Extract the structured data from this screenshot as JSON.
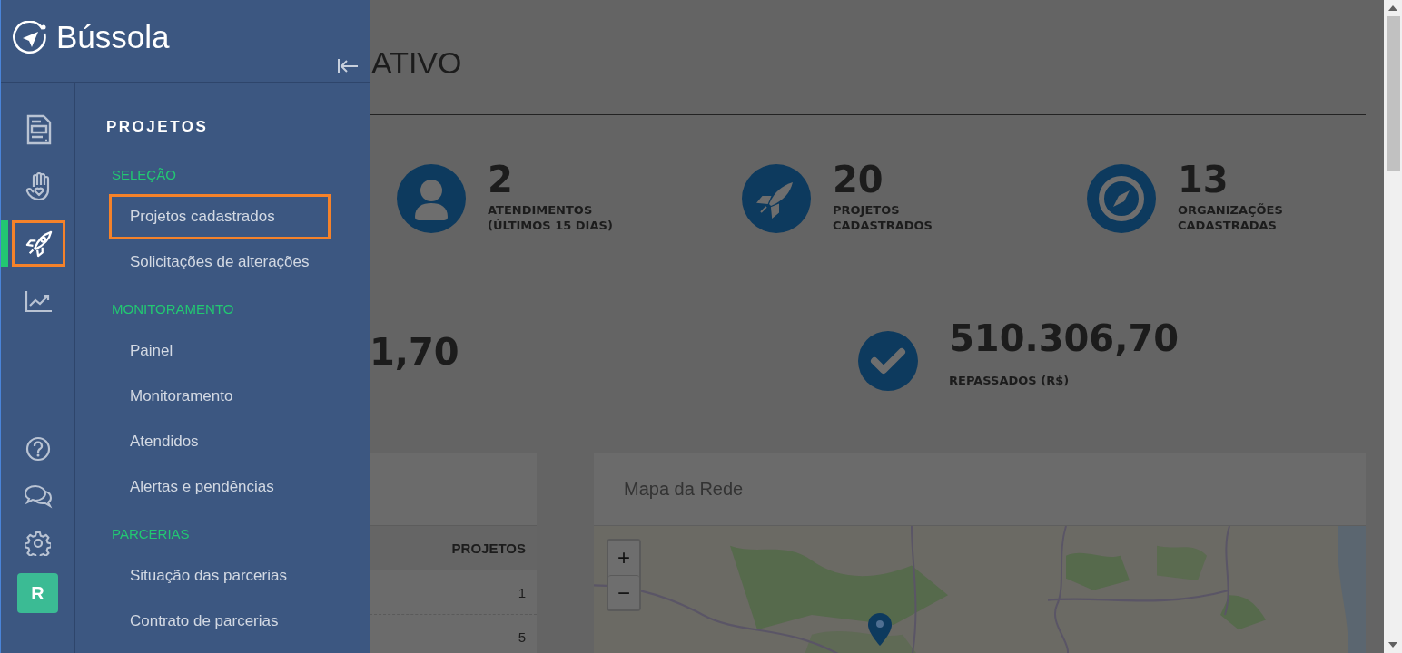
{
  "sidebar": {
    "brand": "Bússola",
    "rail": [
      {
        "kind": "document",
        "selected": false,
        "highlighted": false
      },
      {
        "kind": "hand",
        "selected": false,
        "highlighted": false
      },
      {
        "kind": "rocket",
        "selected": true,
        "highlighted": true
      },
      {
        "kind": "chart",
        "selected": false,
        "highlighted": false
      }
    ],
    "rail_bottom": [
      {
        "kind": "help"
      },
      {
        "kind": "chat"
      },
      {
        "kind": "settings"
      }
    ],
    "avatar": "R",
    "menu": {
      "title": "PROJETOS",
      "sections": [
        {
          "heading": "SELEÇÃO",
          "items": [
            {
              "label": "Projetos cadastrados",
              "highlighted": true
            },
            {
              "label": "Solicitações de alterações",
              "highlighted": false
            }
          ]
        },
        {
          "heading": "MONITORAMENTO",
          "items": [
            {
              "label": "Painel",
              "highlighted": false
            },
            {
              "label": "Monitoramento",
              "highlighted": false
            },
            {
              "label": "Atendidos",
              "highlighted": false
            },
            {
              "label": "Alertas e pendências",
              "highlighted": false
            }
          ]
        },
        {
          "heading": "PARCERIAS",
          "items": [
            {
              "label": "Situação das parcerias",
              "highlighted": false
            },
            {
              "label": "Contrato de parcerias",
              "highlighted": false
            }
          ]
        }
      ]
    }
  },
  "main": {
    "title": "ATIVO",
    "stats": [
      {
        "kind": "person",
        "value": "2",
        "label": "ATENDIMENTOS (ÚLTIMOS 15 DIAS)"
      },
      {
        "kind": "rocket",
        "value": "20",
        "label": "PROJETOS CADASTRADOS"
      },
      {
        "kind": "compass",
        "value": "13",
        "label": "ORGANIZAÇÕES CADASTRADAS"
      }
    ],
    "totals": [
      {
        "value": "1,70"
      },
      {
        "kind": "check",
        "value": "510.306,70",
        "label": "REPASSADOS (R$)"
      }
    ],
    "table": {
      "columns": [
        "PROJETOS"
      ],
      "rows": [
        [
          "1"
        ],
        [
          "5"
        ]
      ]
    },
    "map": {
      "title": "Mapa da Rede",
      "zoom_in": "+",
      "zoom_out": "−"
    }
  }
}
